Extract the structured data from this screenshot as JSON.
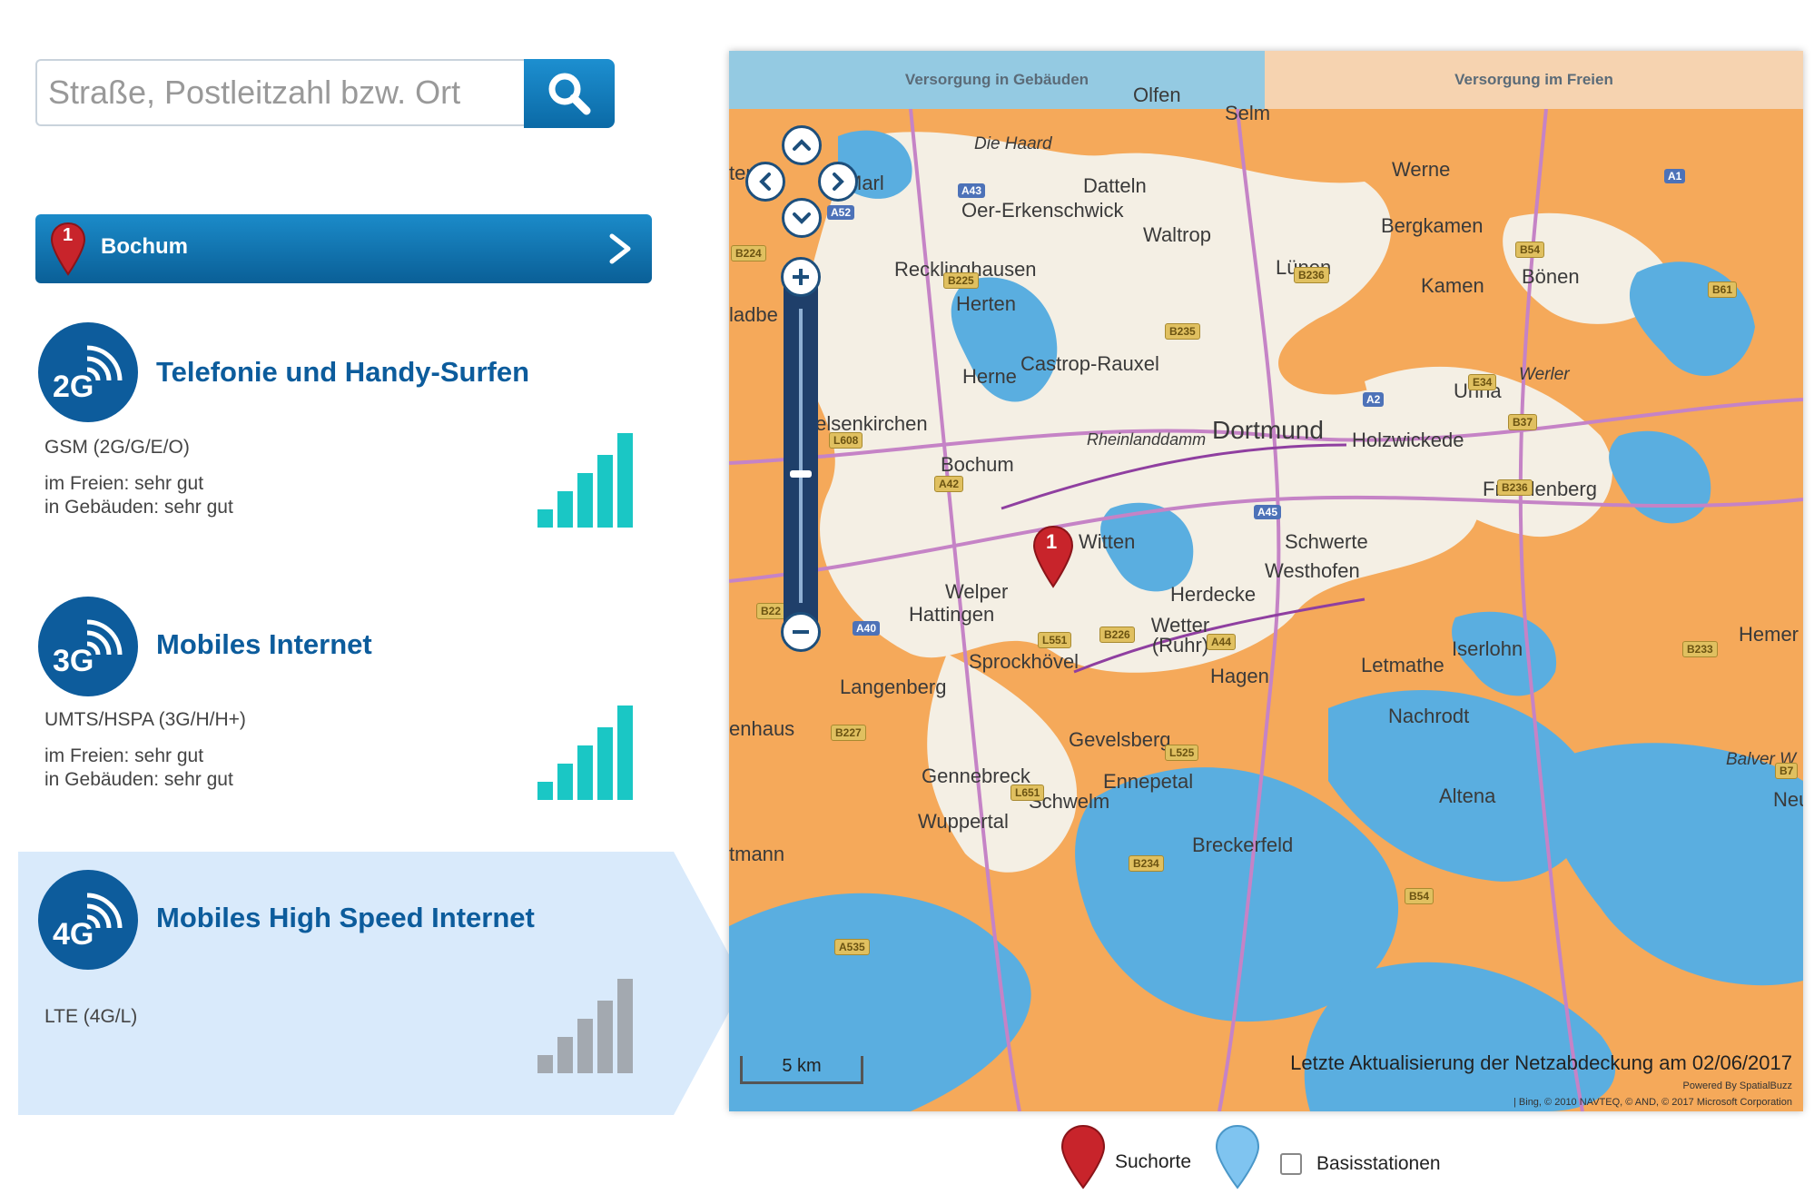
{
  "search": {
    "placeholder": "Straße, Postleitzahl bzw. Ort"
  },
  "location": {
    "number": "1",
    "name": "Bochum"
  },
  "networks": [
    {
      "gen": "2G",
      "title": "Telefonie und Handy-Surfen",
      "tech": "GSM (2G/G/E/O)",
      "outdoor": "im Freien: sehr gut",
      "indoor": "in Gebäuden: sehr gut",
      "signal_level": 5,
      "color": "#1ac7c5"
    },
    {
      "gen": "3G",
      "title": "Mobiles Internet",
      "tech": "UMTS/HSPA (3G/H/H+)",
      "outdoor": "im Freien: sehr gut",
      "indoor": "in Gebäuden: sehr gut",
      "signal_level": 5,
      "color": "#1ac7c5"
    },
    {
      "gen": "4G",
      "title": "Mobiles High Speed Internet",
      "tech": "LTE (4G/L)",
      "signal_level": 0,
      "color": "#9ea4ab"
    }
  ],
  "map": {
    "tabs": [
      "Versorgung in Gebäuden",
      "Versorgung im Freien"
    ],
    "marker_label": "1",
    "towns": [
      "Olfen",
      "Selm",
      "Die Haard",
      "Marl",
      "Datteln",
      "Werne",
      "Oer-Erkenschwick",
      "Waltrop",
      "Bergkamen",
      "Recklinghausen",
      "Lünen",
      "Kamen",
      "Bönen",
      "Herten",
      "Castrop-Rauxel",
      "Herne",
      "Unna",
      "Werler",
      "Gelsenkirchen",
      "Dortmund",
      "Holzwickede",
      "Rheinlanddamm",
      "Bochum",
      "Fröndenberg",
      "Witten",
      "Schwerte",
      "Westhofen",
      "Welper",
      "Hattingen",
      "Herdecke",
      "Wetter (Ruhr)",
      "Iserlohn",
      "Hemer",
      "Sprockhövel",
      "Langenberg",
      "Hagen",
      "Letmathe",
      "Gevelsberg",
      "Nachrodt",
      "Gennebreck",
      "Ennepetal",
      "Altena",
      "Schwelm",
      "Wuppertal",
      "Breckerfeld",
      "Balver W",
      "Neu",
      "ten",
      "ladbe",
      "enhaus",
      "tmann"
    ],
    "roads": [
      "A43",
      "A52",
      "B224",
      "B225",
      "B236",
      "B235",
      "B54",
      "B61",
      "A2",
      "E34",
      "B37",
      "A1",
      "L608",
      "A42",
      "A45",
      "B236",
      "B22",
      "A40",
      "L551",
      "B226",
      "A44",
      "B233",
      "B227",
      "L525",
      "L651",
      "B234",
      "B7",
      "B54",
      "A535"
    ],
    "update_text": "Letzte Aktualisierung der Netzabdeckung am 02/06/2017",
    "powered_by": "Powered By SpatialBuzz",
    "copyright": "| Bing, © 2010 NAVTEQ, © AND, © 2017 Microsoft Corporation",
    "scale": "5 km",
    "colors": {
      "coverage": "#5aaee0",
      "no_coverage": "#f5a95a",
      "base": "#f4efe4"
    }
  },
  "legend": {
    "search_places": "Suchorte",
    "base_stations": "Basisstationen",
    "base_stations_checked": false
  }
}
